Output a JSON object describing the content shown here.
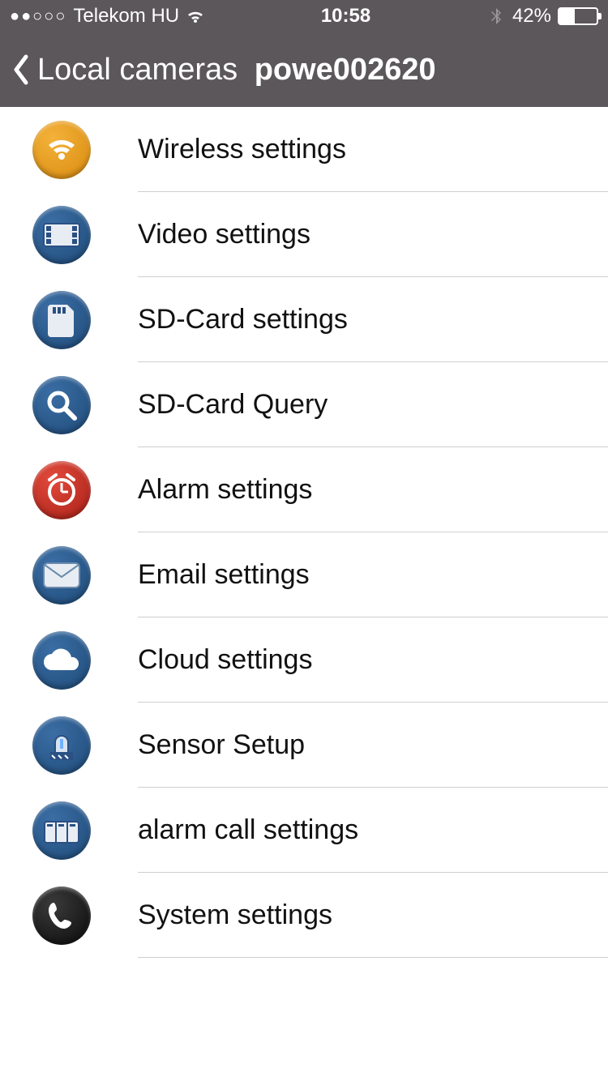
{
  "status": {
    "carrier": "Telekom HU",
    "time": "10:58",
    "battery_pct": "42%"
  },
  "nav": {
    "back_label": "Local cameras",
    "device_name": "powe002620"
  },
  "menu": {
    "items": [
      {
        "label": "Wireless settings",
        "icon": "wifi-icon",
        "color": "orange"
      },
      {
        "label": "Video settings",
        "icon": "film-icon",
        "color": "blue"
      },
      {
        "label": "SD-Card settings",
        "icon": "sdcard-icon",
        "color": "blue"
      },
      {
        "label": "SD-Card Query",
        "icon": "magnifier-icon",
        "color": "blue"
      },
      {
        "label": "Alarm settings",
        "icon": "clock-icon",
        "color": "red"
      },
      {
        "label": "Email settings",
        "icon": "envelope-icon",
        "color": "blue"
      },
      {
        "label": "Cloud settings",
        "icon": "cloud-icon",
        "color": "blue"
      },
      {
        "label": "Sensor Setup",
        "icon": "siren-icon",
        "color": "blue"
      },
      {
        "label": "alarm call settings",
        "icon": "boxes-icon",
        "color": "blue"
      },
      {
        "label": "System settings",
        "icon": "phone-icon",
        "color": "black"
      }
    ]
  }
}
